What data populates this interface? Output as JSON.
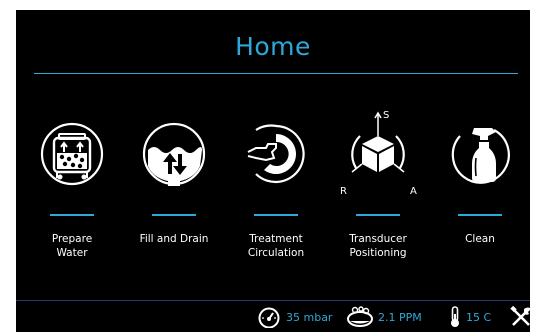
{
  "header": {
    "title": "Home"
  },
  "tiles": [
    {
      "label_line1": "Prepare",
      "label_line2": "Water",
      "icon": "water-tank-icon"
    },
    {
      "label_line1": "Fill and Drain",
      "label_line2": "",
      "icon": "fill-drain-icon"
    },
    {
      "label_line1": "Treatment",
      "label_line2": "Circulation",
      "icon": "circulation-icon"
    },
    {
      "label_line1": "Transducer",
      "label_line2": "Positioning",
      "icon": "transducer-cube-icon"
    },
    {
      "label_line1": "Clean",
      "label_line2": "",
      "icon": "spray-bottle-icon"
    }
  ],
  "positioning_axes": {
    "top": "S",
    "left": "R",
    "right": "A"
  },
  "status": {
    "pressure": "35 mbar",
    "oxygen": "2.1 PPM",
    "temperature": "15 C"
  },
  "colors": {
    "accent": "#2ea8d8",
    "background": "#000000",
    "text": "#ffffff",
    "divider": "#1f3f6e"
  }
}
